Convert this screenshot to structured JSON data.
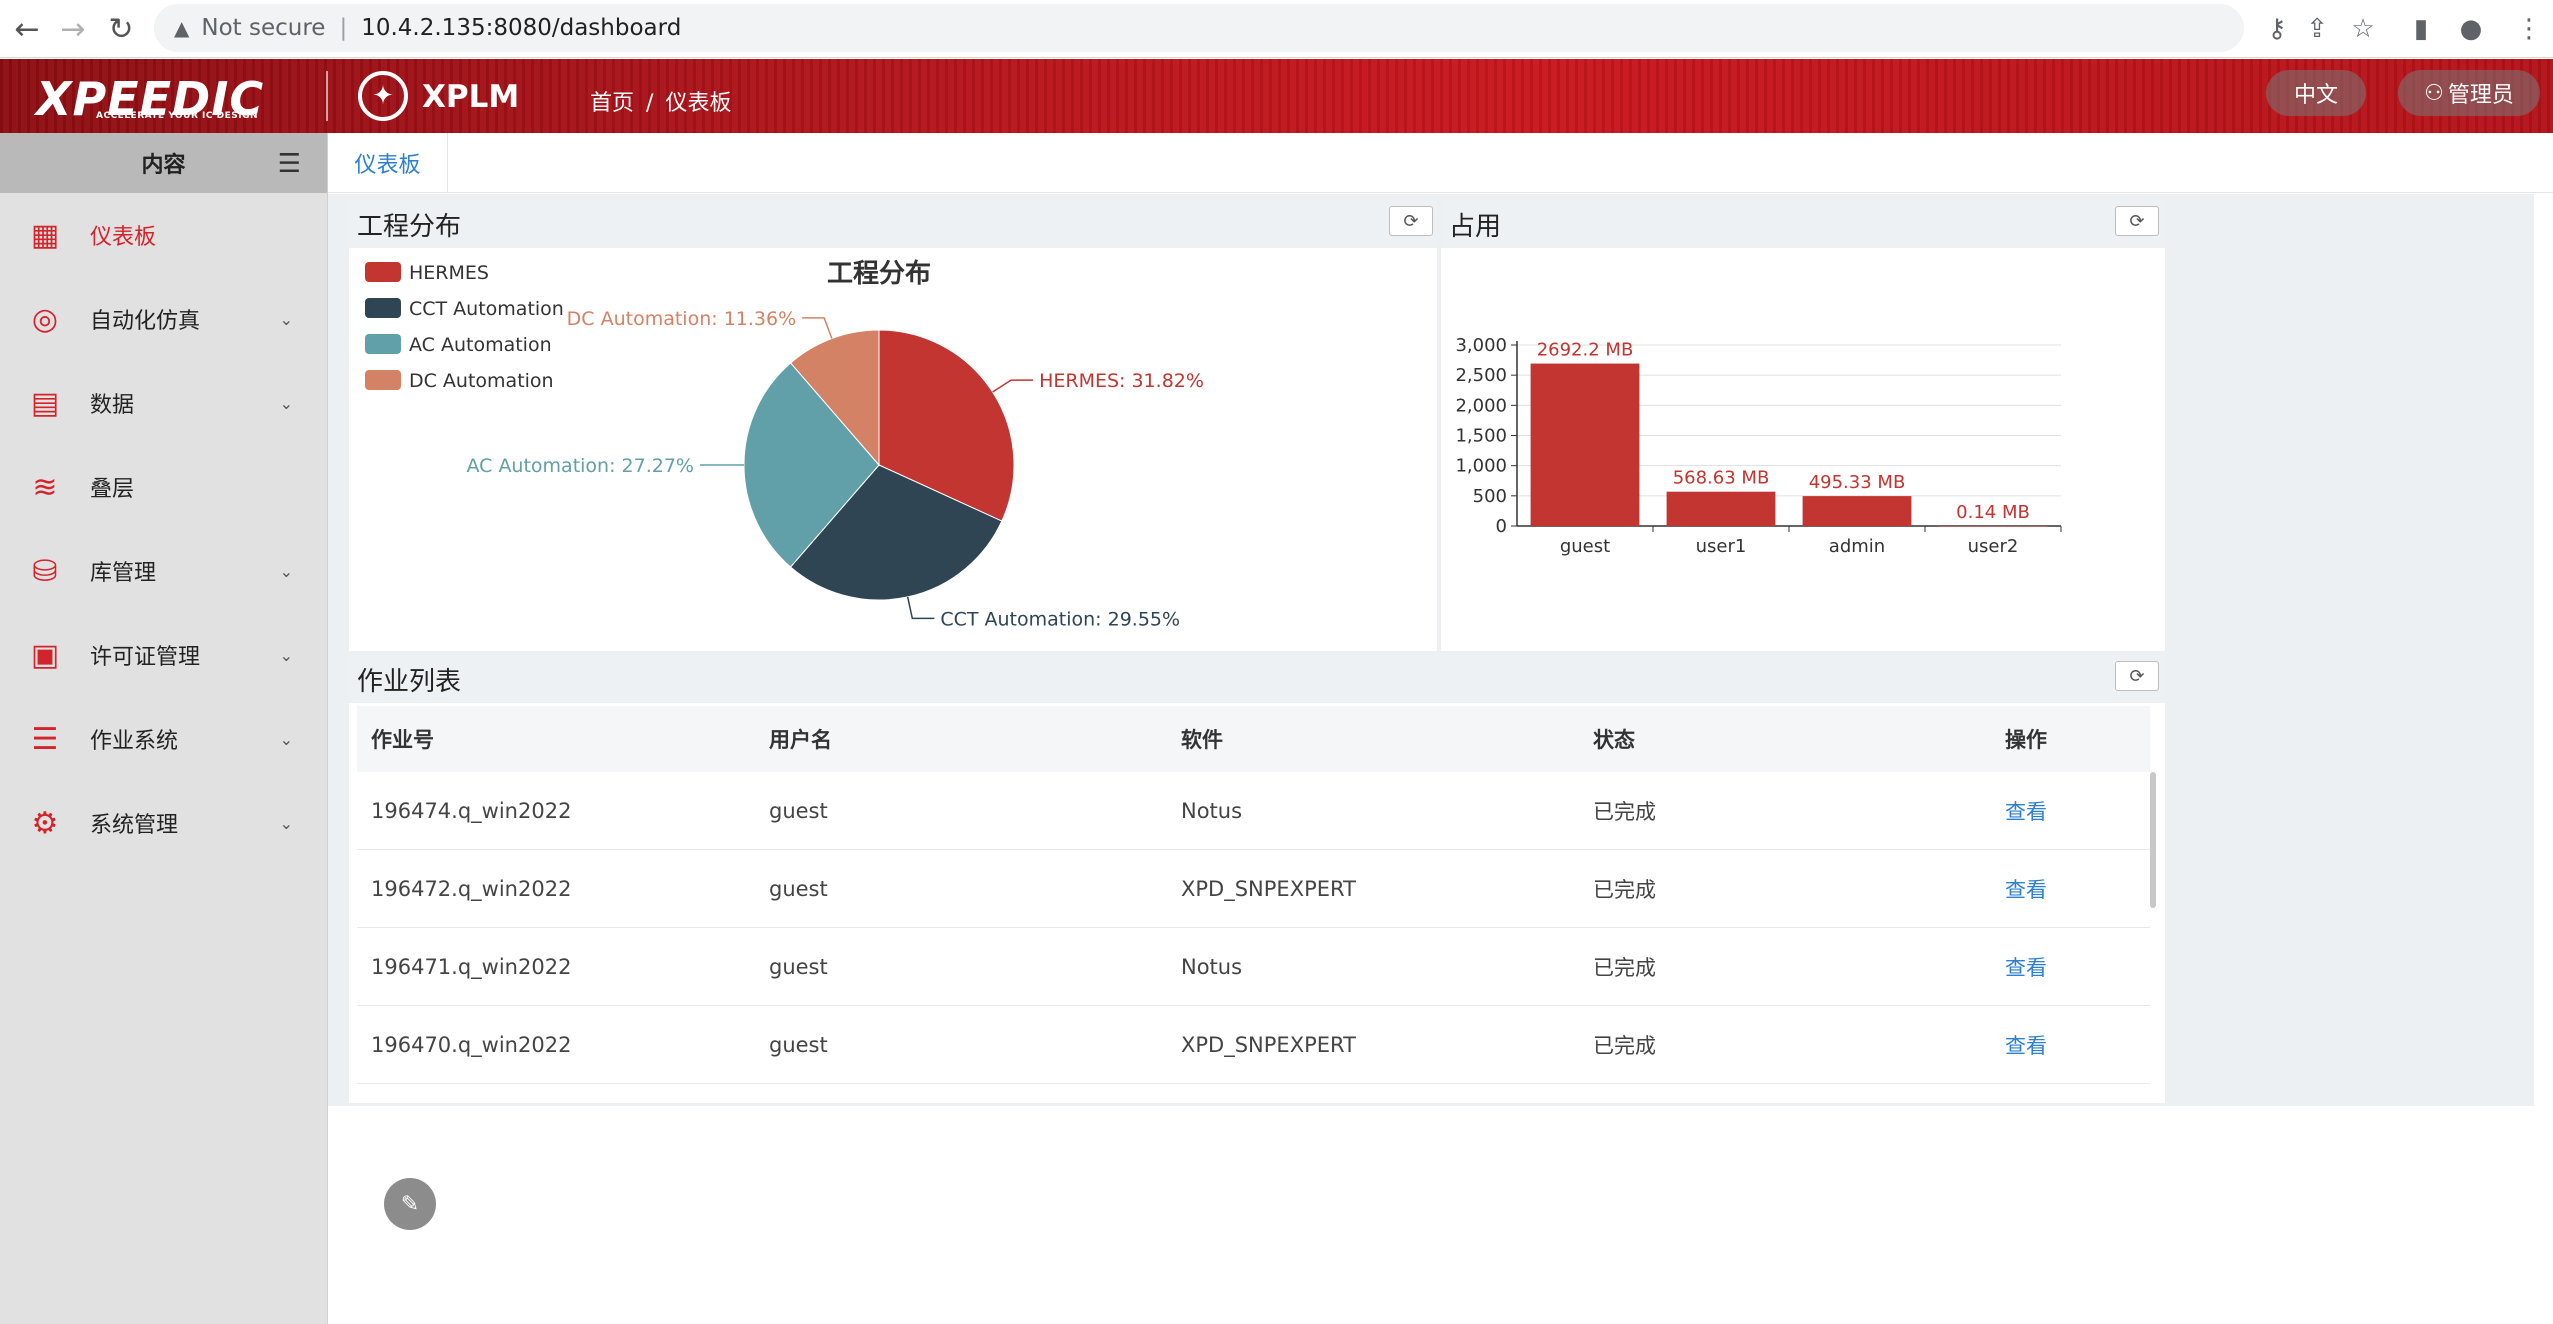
{
  "browser": {
    "url_host": "10.4.2.135:8080/dashboard",
    "not_secure": "Not secure"
  },
  "header": {
    "logo": "XPEEDIC",
    "logo_tagline": "ACCELERATE YOUR IC DESIGN",
    "app_name": "XPLM",
    "breadcrumb_home": "首页",
    "breadcrumb_sep": "/",
    "breadcrumb_current": "仪表板",
    "lang_button": "中文",
    "user_button": "管理员"
  },
  "sidebar": {
    "title": "内容",
    "items": [
      {
        "label": "仪表板",
        "icon": "dashboard-icon",
        "active": true,
        "expandable": false
      },
      {
        "label": "自动化仿真",
        "icon": "automation-icon",
        "active": false,
        "expandable": true
      },
      {
        "label": "数据",
        "icon": "data-icon",
        "active": false,
        "expandable": true
      },
      {
        "label": "叠层",
        "icon": "stackup-icon",
        "active": false,
        "expandable": false
      },
      {
        "label": "库管理",
        "icon": "library-icon",
        "active": false,
        "expandable": true
      },
      {
        "label": "许可证管理",
        "icon": "license-icon",
        "active": false,
        "expandable": true
      },
      {
        "label": "作业系统",
        "icon": "job-icon",
        "active": false,
        "expandable": true
      },
      {
        "label": "系统管理",
        "icon": "gear-icon",
        "active": false,
        "expandable": true
      }
    ]
  },
  "tabs": [
    {
      "label": "仪表板"
    }
  ],
  "panels": {
    "project_distribution": "工程分布",
    "usage": "占用",
    "job_list": "作业列表"
  },
  "chart_data": [
    {
      "type": "pie",
      "title": "工程分布",
      "legend_position": "top-left",
      "series": [
        {
          "name": "HERMES",
          "value": 31.82,
          "label": "HERMES: 31.82%",
          "color": "#c23531"
        },
        {
          "name": "CCT Automation",
          "value": 29.55,
          "label": "CCT Automation: 29.55%",
          "color": "#2f4554"
        },
        {
          "name": "AC Automation",
          "value": 27.27,
          "label": "AC Automation: 27.27%",
          "color": "#61a0a8"
        },
        {
          "name": "DC Automation",
          "value": 11.36,
          "label": "DC Automation: 11.36%",
          "color": "#d48265"
        }
      ]
    },
    {
      "type": "bar",
      "categories": [
        "guest",
        "user1",
        "admin",
        "user2"
      ],
      "values": [
        2692.2,
        568.63,
        495.33,
        0.14
      ],
      "data_labels": [
        "2692.2 MB",
        "568.63 MB",
        "495.33 MB",
        "0.14 MB"
      ],
      "ylim": [
        0,
        3000
      ],
      "yticks": [
        "0",
        "500",
        "1,000",
        "1,500",
        "2,000",
        "2,500",
        "3,000"
      ],
      "color": "#c23531",
      "grid": true
    }
  ],
  "table": {
    "headers": [
      "作业号",
      "用户名",
      "软件",
      "状态",
      "操作"
    ],
    "rows": [
      [
        "196474.q_win2022",
        "guest",
        "Notus",
        "已完成",
        "查看"
      ],
      [
        "196472.q_win2022",
        "guest",
        "XPD_SNPEXPERT",
        "已完成",
        "查看"
      ],
      [
        "196471.q_win2022",
        "guest",
        "Notus",
        "已完成",
        "查看"
      ],
      [
        "196470.q_win2022",
        "guest",
        "XPD_SNPEXPERT",
        "已完成",
        "查看"
      ]
    ]
  }
}
